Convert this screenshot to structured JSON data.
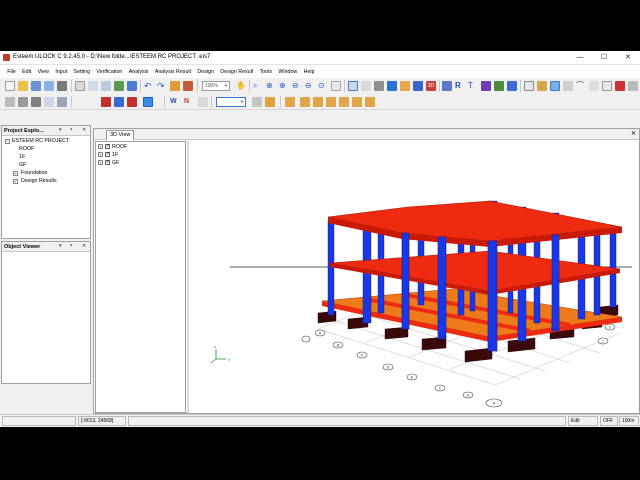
{
  "window": {
    "title": "Esteem ULOCK C 9.2.45.0 - D:\\New folde...\\ESTEEM RC PROJECT .eis7",
    "minimize": "—",
    "maximize": "☐",
    "close": "✕"
  },
  "menu": [
    "File",
    "Edit",
    "View",
    "Input",
    "Setting",
    "Verification",
    "Analysis",
    "Analysis Result",
    "Design",
    "Design Result",
    "Tools",
    "Window",
    "Help"
  ],
  "toolbar": {
    "zoom_value": "100%",
    "combo2_value": ""
  },
  "project_explorer": {
    "title": "Project Explo...",
    "pin": "▾",
    "dock": "ᵠ",
    "close": "✕",
    "root": "ESTEEM RC PROJECT",
    "items": [
      "ROOF",
      "1F",
      "GF",
      "Foundation",
      "Design Results"
    ]
  },
  "object_viewer": {
    "title": "Object Viewer",
    "pin": "▾",
    "dock": "ᵠ",
    "close": "✕"
  },
  "document": {
    "tab_label": "3D View",
    "tab_close": "✕",
    "layers": [
      {
        "label": "ROOF",
        "checked": true
      },
      {
        "label": "1F",
        "checked": true
      },
      {
        "label": "GF",
        "checked": true
      }
    ],
    "grid_labels": [
      "A",
      "B",
      "C",
      "D",
      "E",
      "F",
      "G",
      "H",
      "1",
      "2",
      "3",
      "4",
      "5",
      "6",
      "7",
      "8",
      "9"
    ]
  },
  "status_bar": {
    "coords": "[-9013, 24568]",
    "mode": "Edit",
    "snap": "OFF",
    "scale": "100m"
  },
  "colors": {
    "slab_red": "#ee2a10",
    "slab_orange": "#ef7a1a",
    "column_blue": "#1c37e6",
    "footing": "#3a0a0a"
  }
}
